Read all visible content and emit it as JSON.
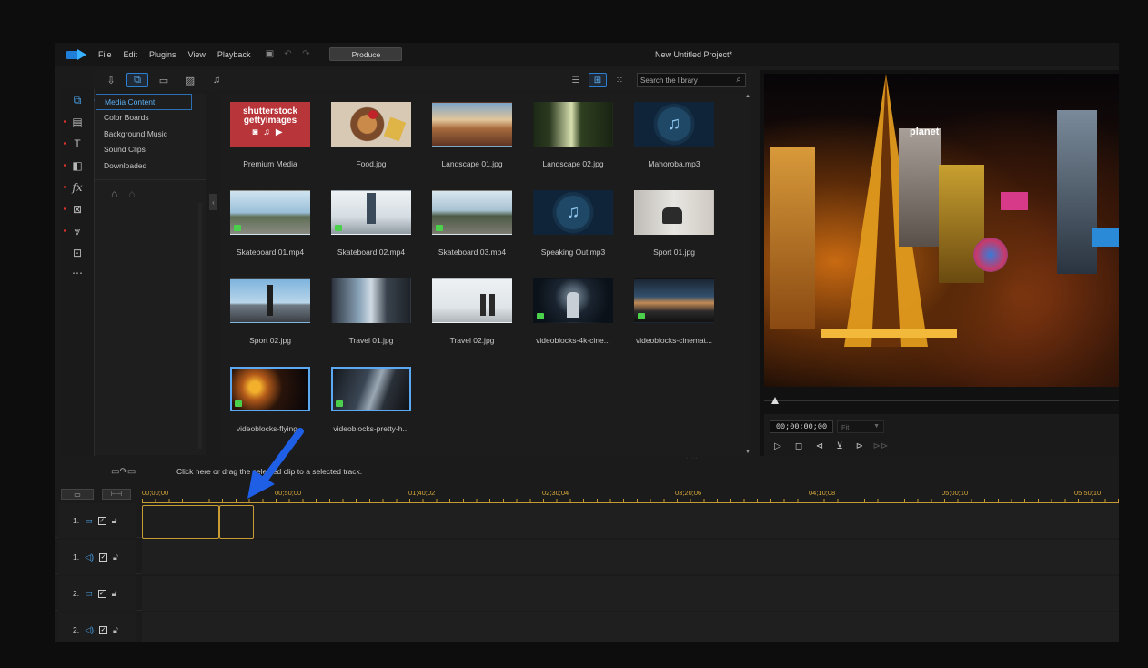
{
  "menu": {
    "items": [
      "File",
      "Edit",
      "Plugins",
      "View",
      "Playback"
    ],
    "produce_label": "Produce",
    "project_title": "New Untitled Project*"
  },
  "library": {
    "search_placeholder": "Search the library",
    "categories": [
      "Media Content",
      "Color Boards",
      "Background Music",
      "Sound Clips",
      "Downloaded"
    ]
  },
  "media_items": [
    {
      "name": "Premium Media"
    },
    {
      "name": "Food.jpg"
    },
    {
      "name": "Landscape 01.jpg"
    },
    {
      "name": "Landscape 02.jpg"
    },
    {
      "name": "Mahoroba.mp3"
    },
    {
      "name": "Skateboard 01.mp4"
    },
    {
      "name": "Skateboard 02.mp4"
    },
    {
      "name": "Skateboard 03.mp4"
    },
    {
      "name": "Speaking Out.mp3"
    },
    {
      "name": "Sport 01.jpg"
    },
    {
      "name": "Sport 02.jpg"
    },
    {
      "name": "Travel 01.jpg"
    },
    {
      "name": "Travel 02.jpg"
    },
    {
      "name": "videoblocks-4k-cine..."
    },
    {
      "name": "videoblocks-cinemat..."
    },
    {
      "name": "videoblocks-flying..."
    },
    {
      "name": "videoblocks-pretty-h..."
    }
  ],
  "premium_banner": {
    "line1": "shutterstock",
    "line2": "gettyimages"
  },
  "preview": {
    "timecode": "00;00;00;00",
    "fit_label": "Fit",
    "sign_text": "planet"
  },
  "timeline": {
    "hint": "Click here or drag the selected clip to a selected track.",
    "ruler_labels": [
      "00;00;00",
      "00;50;00",
      "01;40;02",
      "02;30;04",
      "03;20;06",
      "04;10;08",
      "05;00;10",
      "05;50;10"
    ],
    "tracks": [
      {
        "label": "1.",
        "type": "video"
      },
      {
        "label": "1.",
        "type": "audio"
      },
      {
        "label": "2.",
        "type": "video"
      },
      {
        "label": "2.",
        "type": "audio"
      }
    ]
  },
  "colors": {
    "accent": "#2d7fd0",
    "timeline_gold": "#c69b33",
    "arrow": "#1f5fe6"
  }
}
